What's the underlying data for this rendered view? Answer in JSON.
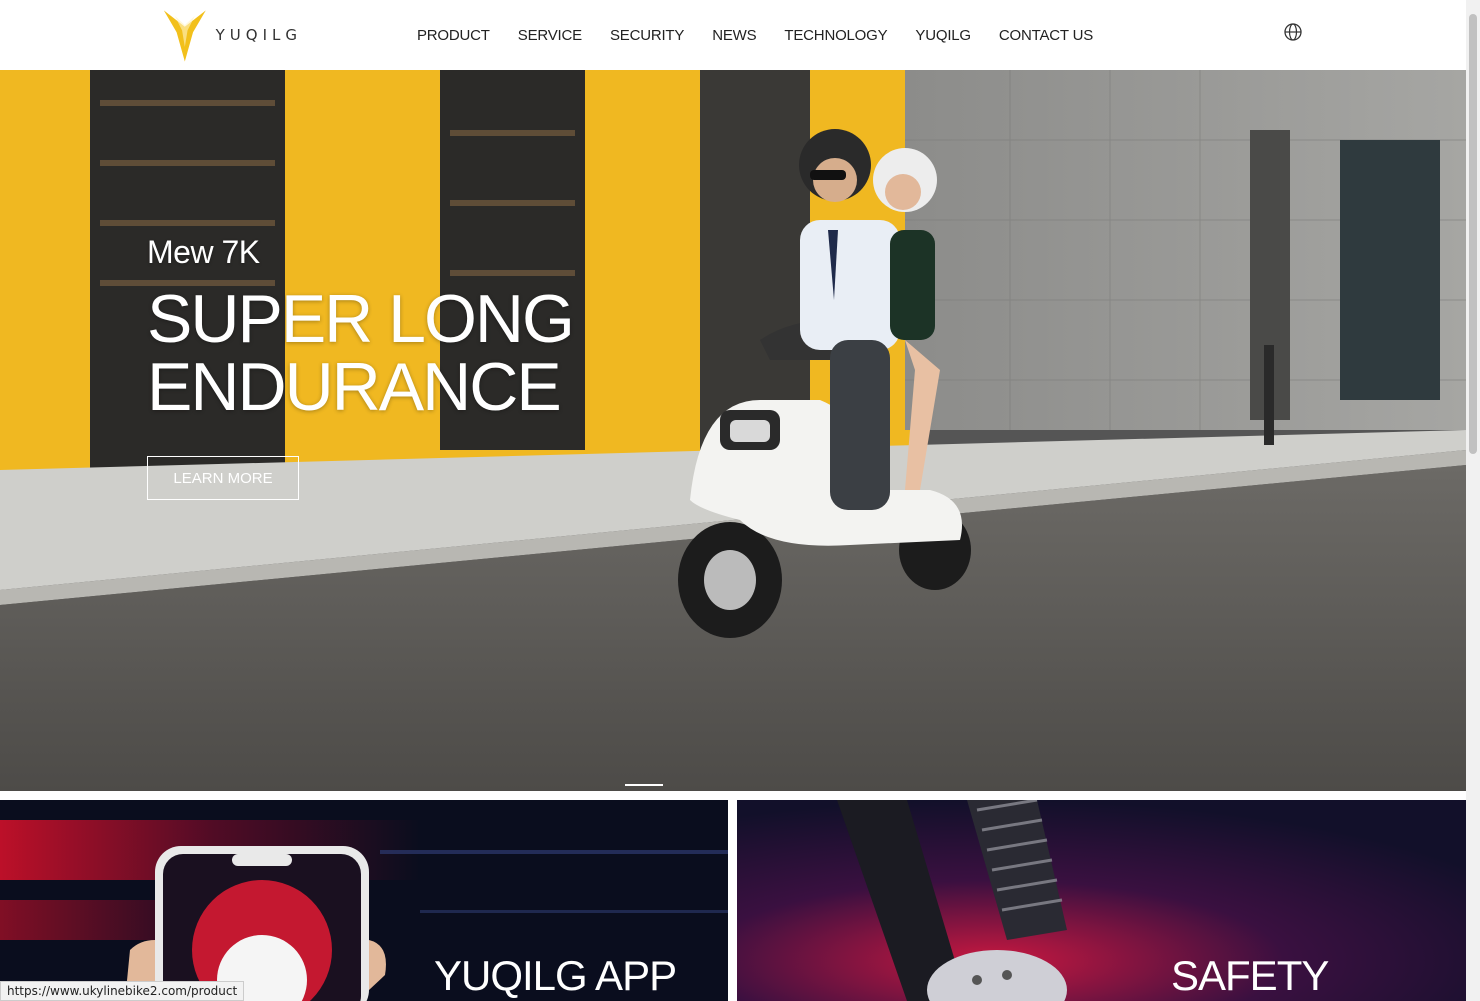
{
  "header": {
    "logo_text": "YUQILG",
    "nav": [
      "PRODUCT",
      "SERVICE",
      "SECURITY",
      "NEWS",
      "TECHNOLOGY",
      "YUQILG",
      "CONTACT US"
    ],
    "globe_icon": "globe-icon"
  },
  "hero": {
    "subtitle": "Mew 7K",
    "title_line1": "SUPER LONG",
    "title_line2": "ENDURANCE",
    "button": "LEARN MORE",
    "slides": 2,
    "active_slide": 1
  },
  "cards": {
    "app_title": "YUQILG APP",
    "safety_title": "SAFETY"
  },
  "status_bar": {
    "url": "https://www.ukylinebike2.com/product"
  },
  "colors": {
    "brand_yellow": "#f2c01b",
    "wall_yellow": "#f0b821",
    "text_dark": "#222222"
  }
}
